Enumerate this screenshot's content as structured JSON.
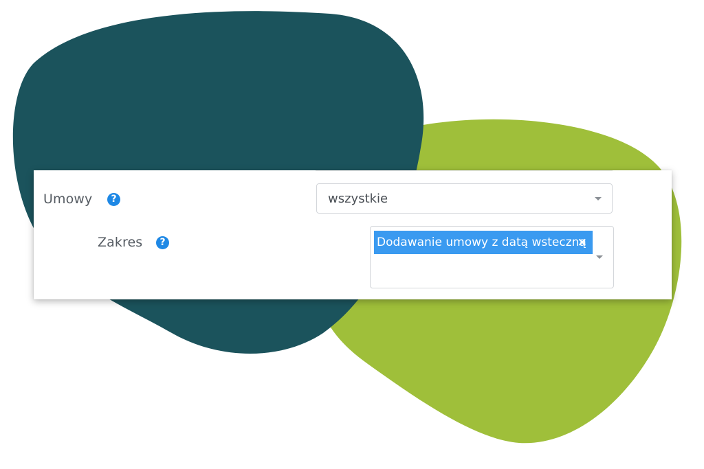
{
  "colors": {
    "dark_blob": "#1b535c",
    "green_blob": "#9fbf3a",
    "help_icon": "#1e88e5",
    "tag_background": "#3a9af0"
  },
  "form": {
    "umowy": {
      "label": "Umowy",
      "help_icon": "question-circle-icon",
      "select_value": "wszystkie"
    },
    "zakres": {
      "label": "Zakres",
      "help_icon": "question-circle-icon",
      "selected_tags": [
        {
          "label": "Dodawanie umowy z datą wsteczną",
          "remove_glyph": "×"
        }
      ]
    }
  }
}
